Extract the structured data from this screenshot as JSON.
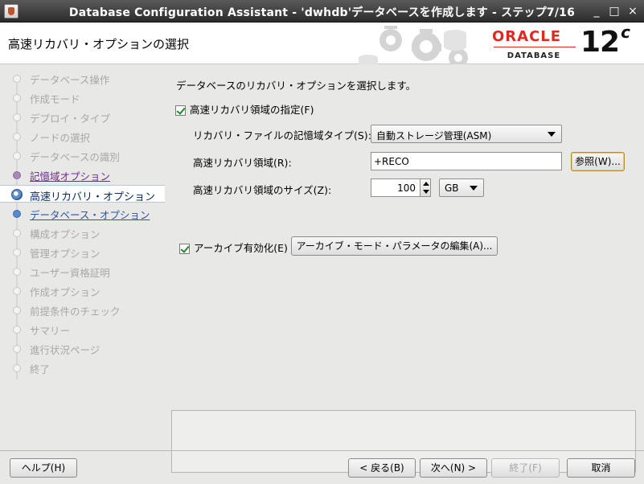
{
  "window": {
    "title": "Database Configuration Assistant - 'dwhdb'データベースを作成します - ステップ7/16",
    "minimize_glyph": "_",
    "maximize_glyph": "□",
    "close_glyph": "×"
  },
  "header": {
    "page_title": "高速リカバリ・オプションの選択",
    "oracle_text": "ORACLE",
    "database_text": "DATABASE",
    "version": "12",
    "version_sup": "c"
  },
  "steps": [
    {
      "label": "データベース操作",
      "state": "inactive"
    },
    {
      "label": "作成モード",
      "state": "inactive"
    },
    {
      "label": "デプロイ・タイプ",
      "state": "inactive"
    },
    {
      "label": "ノードの選択",
      "state": "inactive"
    },
    {
      "label": "データベースの識別",
      "state": "inactive"
    },
    {
      "label": "記憶域オプション",
      "state": "done"
    },
    {
      "label": "高速リカバリ・オプション",
      "state": "current"
    },
    {
      "label": "データベース・オプション",
      "state": "next"
    },
    {
      "label": "構成オプション",
      "state": "inactive"
    },
    {
      "label": "管理オプション",
      "state": "inactive"
    },
    {
      "label": "ユーザー資格証明",
      "state": "inactive"
    },
    {
      "label": "作成オプション",
      "state": "inactive"
    },
    {
      "label": "前提条件のチェック",
      "state": "inactive"
    },
    {
      "label": "サマリー",
      "state": "inactive"
    },
    {
      "label": "進行状況ページ",
      "state": "inactive"
    },
    {
      "label": "終了",
      "state": "inactive"
    }
  ],
  "content": {
    "intro": "データベースのリカバリ・オプションを選択します。",
    "fra_checkbox_label": "高速リカバリ領域の指定(F)",
    "fra_checked": true,
    "storage_type_label": "リカバリ・ファイルの記憶域タイプ(S):",
    "storage_type_value": "自動ストレージ管理(ASM)",
    "fra_location_label": "高速リカバリ領域(R):",
    "fra_location_value": "+RECO",
    "browse_button": "参照(W)...",
    "fra_size_label": "高速リカバリ領域のサイズ(Z):",
    "fra_size_value": "100",
    "fra_size_unit": "GB",
    "archive_checkbox_label": "アーカイブ有効化(E)",
    "archive_checked": true,
    "archive_params_button": "アーカイブ・モード・パラメータの編集(A)..."
  },
  "footer": {
    "help": "ヘルプ(H)",
    "back": "< 戻る(B)",
    "next": "次へ(N) >",
    "finish": "終了(F)",
    "cancel": "取消"
  },
  "colors": {
    "oracle_red": "#e0281e",
    "done_step": "#6e2a8a",
    "next_step": "#2c55a8",
    "current_step": "#0b2c67"
  }
}
